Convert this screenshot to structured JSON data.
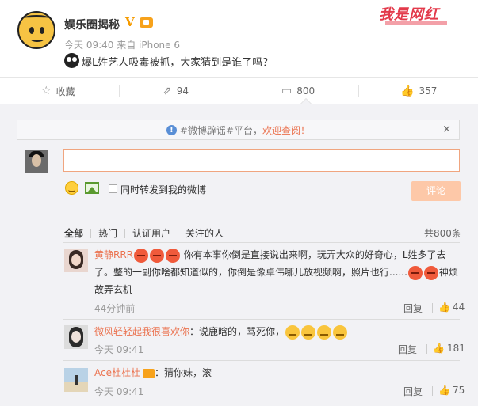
{
  "post": {
    "author": "娱乐圈揭秘",
    "verified_mark": "V",
    "meta": "今天 09:40 来自 iPhone 6",
    "text": "爆L姓艺人吸毒被抓，大家猜到是谁了吗？",
    "watermark": "我是网红"
  },
  "actions": {
    "favorite": "收藏",
    "repost": "94",
    "comment": "800",
    "like": "357"
  },
  "comments_panel": {
    "notice_prefix": "#微博辟谣#平台，",
    "notice_highlight": "欢迎查阅！",
    "close": "×",
    "input_value": "",
    "repost_checkbox_label": "同时转发到我的微博",
    "submit_label": "评论",
    "filters": [
      "全部",
      "热门",
      "认证用户",
      "关注的人"
    ],
    "total": "共800条",
    "reply_label": "回复"
  },
  "comments": [
    {
      "name": "黄静RRR",
      "text_a": "你有本事你倒是直接说出来啊，玩弄大众的好奇心，L姓多了去",
      "text_b": "了。整的一副你啥都知道似的，你倒是像卓伟哪儿放视频啊，照片也行......",
      "text_c": "神烦",
      "text_d": "故弄玄机",
      "time": "44分钟前",
      "likes": "44"
    },
    {
      "name": "微风轻轻起我很喜欢你",
      "text": "：说鹿晗的，骂死你，",
      "time": "今天 09:41",
      "likes": "181"
    },
    {
      "name": "Ace杜杜杜",
      "text": "：猜你妹，滚",
      "time": "今天 09:41",
      "likes": "75"
    }
  ],
  "colors": {
    "accent": "#eb7350",
    "submit_disabled": "#fdc8a8",
    "panel_bg": "#f2f2f5",
    "verified": "#f59b00"
  }
}
